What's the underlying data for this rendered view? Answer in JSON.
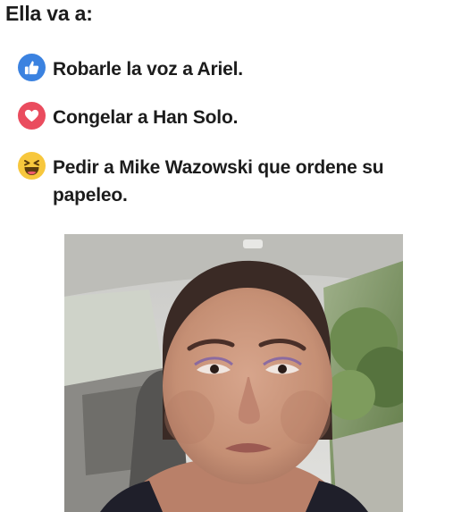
{
  "heading": "Ella va a:",
  "options": [
    {
      "icon": "like-reaction-icon",
      "color": "#3b82e0",
      "text": "Robarle la voz a Ariel."
    },
    {
      "icon": "love-reaction-icon",
      "color": "#ea4c5e",
      "text": "Congelar a Han Solo."
    },
    {
      "icon": "haha-reaction-icon",
      "color": "#f7c73d",
      "text": "Pedir a Mike Wazowski que ordene su papeleo."
    }
  ]
}
